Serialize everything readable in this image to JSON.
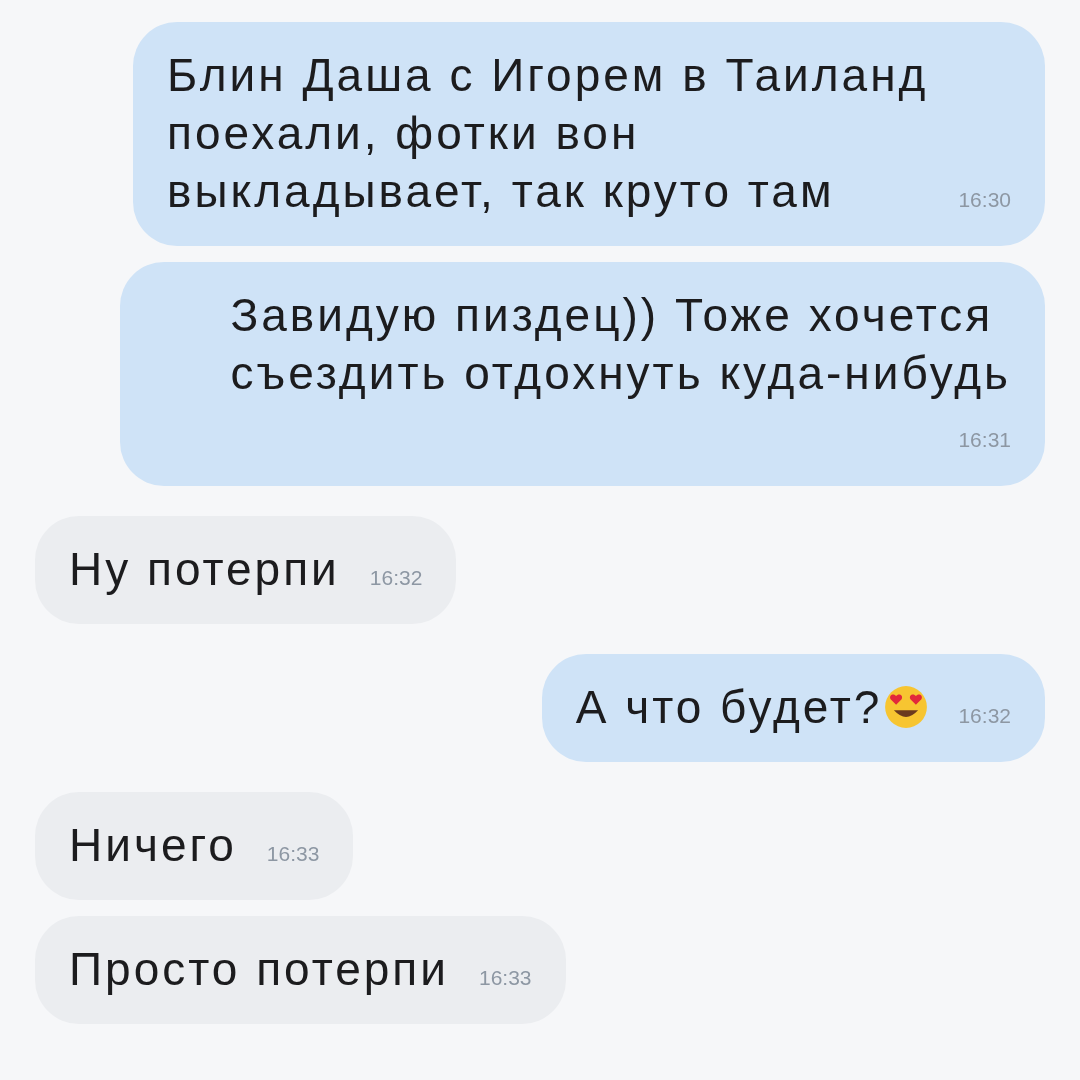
{
  "messages": [
    {
      "text": "Блин Даша с Игорем в Таиланд\nпоехали, фотки вон\nвыкладывает, так круто там",
      "time": "16:30",
      "outgoing": true
    },
    {
      "text": "Завидую пиздец)) Тоже хочется\nсъездить отдохнуть куда-нибудь",
      "time": "16:31",
      "outgoing": true
    },
    {
      "text": "Ну потерпи",
      "time": "16:32",
      "outgoing": false
    },
    {
      "text": "А что будет?",
      "time": "16:32",
      "outgoing": true,
      "emoji": true
    },
    {
      "text": "Ничего",
      "time": "16:33",
      "outgoing": false
    },
    {
      "text": "Просто потерпи",
      "time": "16:33",
      "outgoing": false
    }
  ]
}
